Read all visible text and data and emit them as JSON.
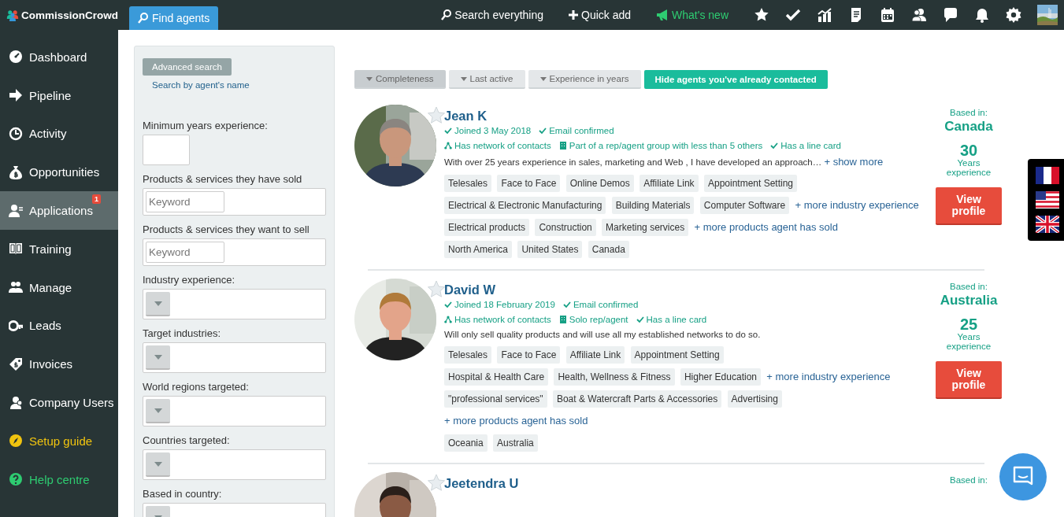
{
  "topbar": {
    "logo": "CommissionCrowd",
    "tabs": [
      {
        "label": "Find agents",
        "selected": true
      }
    ],
    "links": [
      {
        "label": "Search everything",
        "kind": "search"
      },
      {
        "label": "Quick add",
        "kind": "add"
      },
      {
        "label": "What's new",
        "kind": "news"
      }
    ]
  },
  "sidebar": {
    "items": [
      {
        "label": "Dashboard",
        "selected": false,
        "color": "#ffffff"
      },
      {
        "label": "Pipeline",
        "selected": false,
        "color": "#ffffff"
      },
      {
        "label": "Activity",
        "selected": false,
        "color": "#ffffff"
      },
      {
        "label": "Opportunities",
        "selected": false,
        "color": "#ffffff"
      },
      {
        "label": "Applications",
        "selected": true,
        "color": "#ffffff",
        "badge": "1"
      },
      {
        "label": "Training",
        "selected": false,
        "color": "#ffffff"
      },
      {
        "label": "Manage",
        "selected": false,
        "color": "#ffffff"
      },
      {
        "label": "Leads",
        "selected": false,
        "color": "#ffffff"
      },
      {
        "label": "Invoices",
        "selected": false,
        "color": "#ffffff"
      },
      {
        "label": "Company Users",
        "selected": false,
        "color": "#ffffff"
      },
      {
        "label": "Setup guide",
        "selected": false,
        "color": "#f1c40f"
      },
      {
        "label": "Help centre",
        "selected": false,
        "color": "#2ecc71"
      }
    ]
  },
  "filters": {
    "advanced_search_button": "Advanced search",
    "name_search_link": "Search by agent's name",
    "fields": [
      {
        "label": "Minimum years experience:",
        "kind": "number"
      },
      {
        "label": "Products & services they have sold",
        "kind": "keyword",
        "placeholder": "Keyword"
      },
      {
        "label": "Products & services they want to sell",
        "kind": "keyword",
        "placeholder": "Keyword"
      },
      {
        "label": "Industry experience:",
        "kind": "select"
      },
      {
        "label": "Target industries:",
        "kind": "select"
      },
      {
        "label": "World regions targeted:",
        "kind": "select"
      },
      {
        "label": "Countries targeted:",
        "kind": "select"
      },
      {
        "label": "Based in country:",
        "kind": "select"
      }
    ]
  },
  "sort_buttons": [
    {
      "label": "Completeness",
      "selected": true
    },
    {
      "label": "Last active",
      "selected": false
    },
    {
      "label": "Experience in years",
      "selected": false
    }
  ],
  "hide_contacted_button": "Hide agents you've already contacted",
  "agents": [
    {
      "name": "Jean K",
      "meta": [
        [
          {
            "kind": "check",
            "text": "Joined 3 May 2018"
          },
          {
            "kind": "check",
            "text": "Email confirmed"
          }
        ],
        [
          {
            "kind": "network",
            "text": "Has network of contacts"
          },
          {
            "kind": "building",
            "text": "Part of a rep/agent group with less than 5 others"
          },
          {
            "kind": "check",
            "text": "Has a line card"
          }
        ]
      ],
      "description": "With over 25 years experience in sales, marketing and Web , I have developed an approach…",
      "show_more": "+ show more",
      "tag_rows": [
        {
          "tags": [
            "Telesales",
            "Face to Face",
            "Online Demos",
            "Affiliate Link",
            "Appointment Setting"
          ]
        },
        {
          "tags": [
            "Electrical & Electronic Manufacturing",
            "Building Materials",
            "Computer Software"
          ],
          "more": "+ more industry experience"
        },
        {
          "tags": [
            "Electrical products",
            "Construction",
            "Marketing services"
          ],
          "more": "+ more products agent has sold"
        },
        {
          "tags": [
            "North America",
            "United States",
            "Canada"
          ]
        }
      ],
      "based_in_label": "Based in:",
      "country": "Canada",
      "years": "30",
      "years_label": "Years experience",
      "button": "View profile"
    },
    {
      "name": "David W",
      "meta": [
        [
          {
            "kind": "check",
            "text": "Joined 18 February 2019"
          },
          {
            "kind": "check",
            "text": "Email confirmed"
          }
        ],
        [
          {
            "kind": "network",
            "text": "Has network of contacts"
          },
          {
            "kind": "building",
            "text": "Solo rep/agent"
          },
          {
            "kind": "check",
            "text": "Has a line card"
          }
        ]
      ],
      "description": "Will only sell quality products and will use all my established networks to do so.",
      "tag_rows": [
        {
          "tags": [
            "Telesales",
            "Face to Face",
            "Affiliate Link",
            "Appointment Setting"
          ]
        },
        {
          "tags": [
            "Hospital & Health Care",
            "Health, Wellness & Fitness",
            "Higher Education"
          ],
          "more": "+ more industry experience"
        },
        {
          "tags": [
            "\"professional services\"",
            "Boat & Watercraft Parts & Accessories",
            "Advertising"
          ],
          "more": "+ more products agent has sold"
        },
        {
          "tags": [
            "Oceania",
            "Australia"
          ]
        }
      ],
      "based_in_label": "Based in:",
      "country": "Australia",
      "years": "25",
      "years_label": "Years experience",
      "button": "View profile"
    },
    {
      "name": "Jeetendra U",
      "based_in_label": "Based in:"
    }
  ]
}
